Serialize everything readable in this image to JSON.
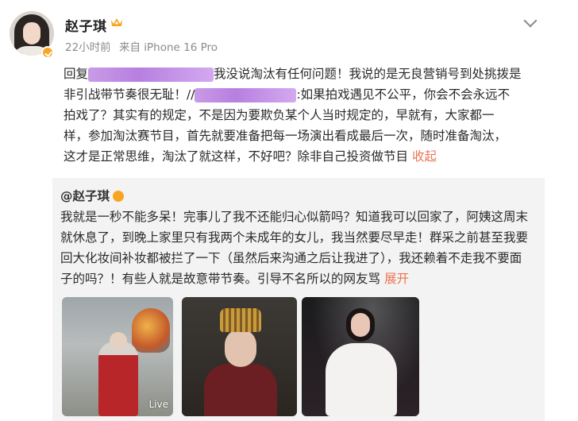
{
  "post": {
    "username": "赵子琪",
    "time": "22小时前",
    "source": "来自 iPhone 16 Pro",
    "reply_prefix": "回复",
    "line1_after": "我没说淘汰有任何问题！我说的是无良营销号到处挑拨是",
    "line2_before": "非引战带节奏很无耻！//",
    "line2_after": ":如果拍戏遇见不公平，你会不会永远不",
    "line3": "拍戏了？其实有的规定，不是因为要欺负某个人当时规定的，早就有，大家都一",
    "line4": "样，参加淘汰赛节目，首先就要准备把每一场演出看成最后一次，随时准备淘汰，",
    "line5": "这才是正常思维，淘汰了就这样，不好吧？除非自己投资做节目",
    "collapse_label": "收起",
    "colors": {
      "accent": "#eb7350",
      "blur": "#c495e8",
      "vip": "#f6a623"
    }
  },
  "repost": {
    "author": "@赵子琪",
    "line1": "我就是一秒不能多呆！完事儿了我不还能归心似箭吗？知道我可以回家了，阿姨这周末",
    "line2": "就休息了，到晚上家里只有我两个未成年的女儿，我当然要尽早走！群采之前甚至我要",
    "line3": "回大化妆间补妆都被拦了一下（虽然后来沟通之后让我进了），我还赖着不走我不要面",
    "line4": "子的吗？！有些人就是故意带节奏。引导不名所以的网友骂",
    "expand_label": "展开",
    "images": [
      {
        "icon": "drama-costume-photo",
        "badge": "Live"
      },
      {
        "icon": "headdress-portrait-photo"
      },
      {
        "icon": "stage-singing-photo"
      }
    ]
  }
}
